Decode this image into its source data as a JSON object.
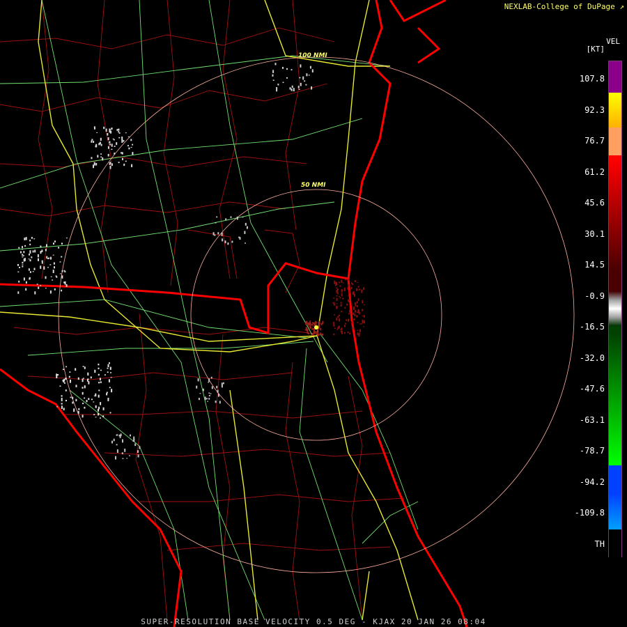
{
  "header": {
    "credit": "NEXLAB-College of DuPage"
  },
  "footer": {
    "product_line": "SUPER-RESOLUTION BASE VELOCITY 0.5 DEG - KJAX 20 JAN 26 08:04"
  },
  "legend": {
    "title": "VEL",
    "unit": "[KT]",
    "ticks": [
      "107.8",
      "92.3",
      "76.7",
      "61.2",
      "45.6",
      "30.1",
      "14.5",
      "-0.9",
      "-16.5",
      "-32.0",
      "-47.6",
      "-63.1",
      "-78.7",
      "-94.2",
      "-109.8",
      "TH"
    ],
    "colors": {
      "purple": "#8b008b",
      "yellow": "#ffff00",
      "orange": "#ffa060",
      "red": "#ff0000",
      "darkred": "#4a0000",
      "gray": "#a0a0a0",
      "darkgreen": "#004000",
      "green": "#00ff00",
      "blue": "#0040ff",
      "cyan": "#00a0ff"
    }
  },
  "range_rings": {
    "inner_label": "50 NMI",
    "outer_label": "100 NMI"
  },
  "map_colors": {
    "county_lines": "#b01010",
    "state_coast": "#ff0000",
    "highways_minor": "#80ff80",
    "interstates": "#ffff40",
    "rings": "#ffb0a0"
  }
}
